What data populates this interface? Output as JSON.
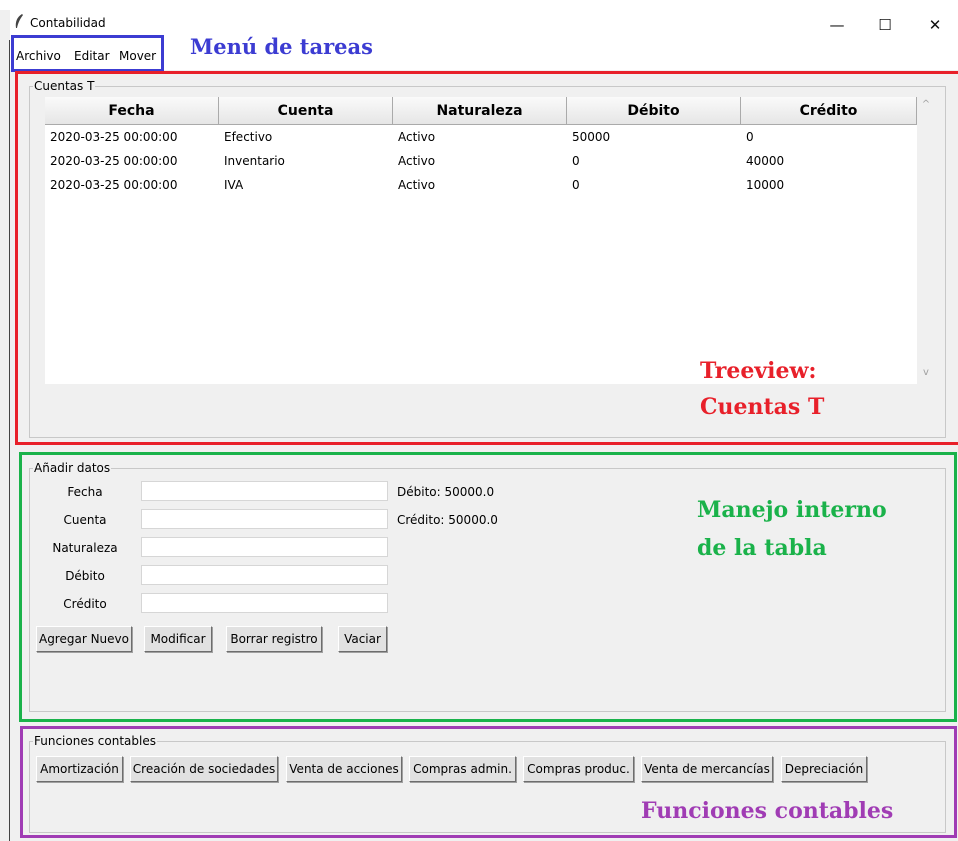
{
  "window": {
    "title": "Contabilidad",
    "min_glyph": "—",
    "max_glyph": "☐",
    "close_glyph": "✕"
  },
  "menu": {
    "items": [
      "Archivo",
      "Editar",
      "Mover"
    ]
  },
  "treeview": {
    "frame_label": "Cuentas T",
    "columns": [
      "Fecha",
      "Cuenta",
      "Naturaleza",
      "Débito",
      "Crédito"
    ],
    "rows": [
      [
        "2020-03-25 00:00:00",
        "Efectivo",
        "Activo",
        "50000",
        "0"
      ],
      [
        "2020-03-25 00:00:00",
        "Inventario",
        "Activo",
        "0",
        "40000"
      ],
      [
        "2020-03-25 00:00:00",
        "IVA",
        "Activo",
        "0",
        "10000"
      ]
    ],
    "scroll_up": "^",
    "scroll_down": "v"
  },
  "form": {
    "frame_label": "Añadir datos",
    "fields": [
      {
        "label": "Fecha",
        "value": ""
      },
      {
        "label": "Cuenta",
        "value": ""
      },
      {
        "label": "Naturaleza",
        "value": ""
      },
      {
        "label": "Débito",
        "value": ""
      },
      {
        "label": "Crédito",
        "value": ""
      }
    ],
    "debito_total": "Débito: 50000.0",
    "credito_total": "Crédito: 50000.0",
    "buttons": [
      "Agregar Nuevo",
      "Modificar",
      "Borrar registro",
      "Vaciar"
    ]
  },
  "funciones": {
    "frame_label": "Funciones contables",
    "buttons": [
      "Amortización",
      "Creación de sociedades",
      "Venta de acciones",
      "Compras admin.",
      "Compras produc.",
      "Venta de mercancías",
      "Depreciación"
    ]
  },
  "annotations": {
    "menu": "Menú de tareas",
    "tree_line1": "Treeview:",
    "tree_line2": "Cuentas T",
    "manejo_line1": "Manejo interno",
    "manejo_line2": "de la tabla",
    "funciones": "Funciones contables"
  },
  "colors": {
    "blue": "#3c3cd2",
    "red": "#e8202a",
    "green": "#1ab24a",
    "purple": "#a03cb4"
  }
}
